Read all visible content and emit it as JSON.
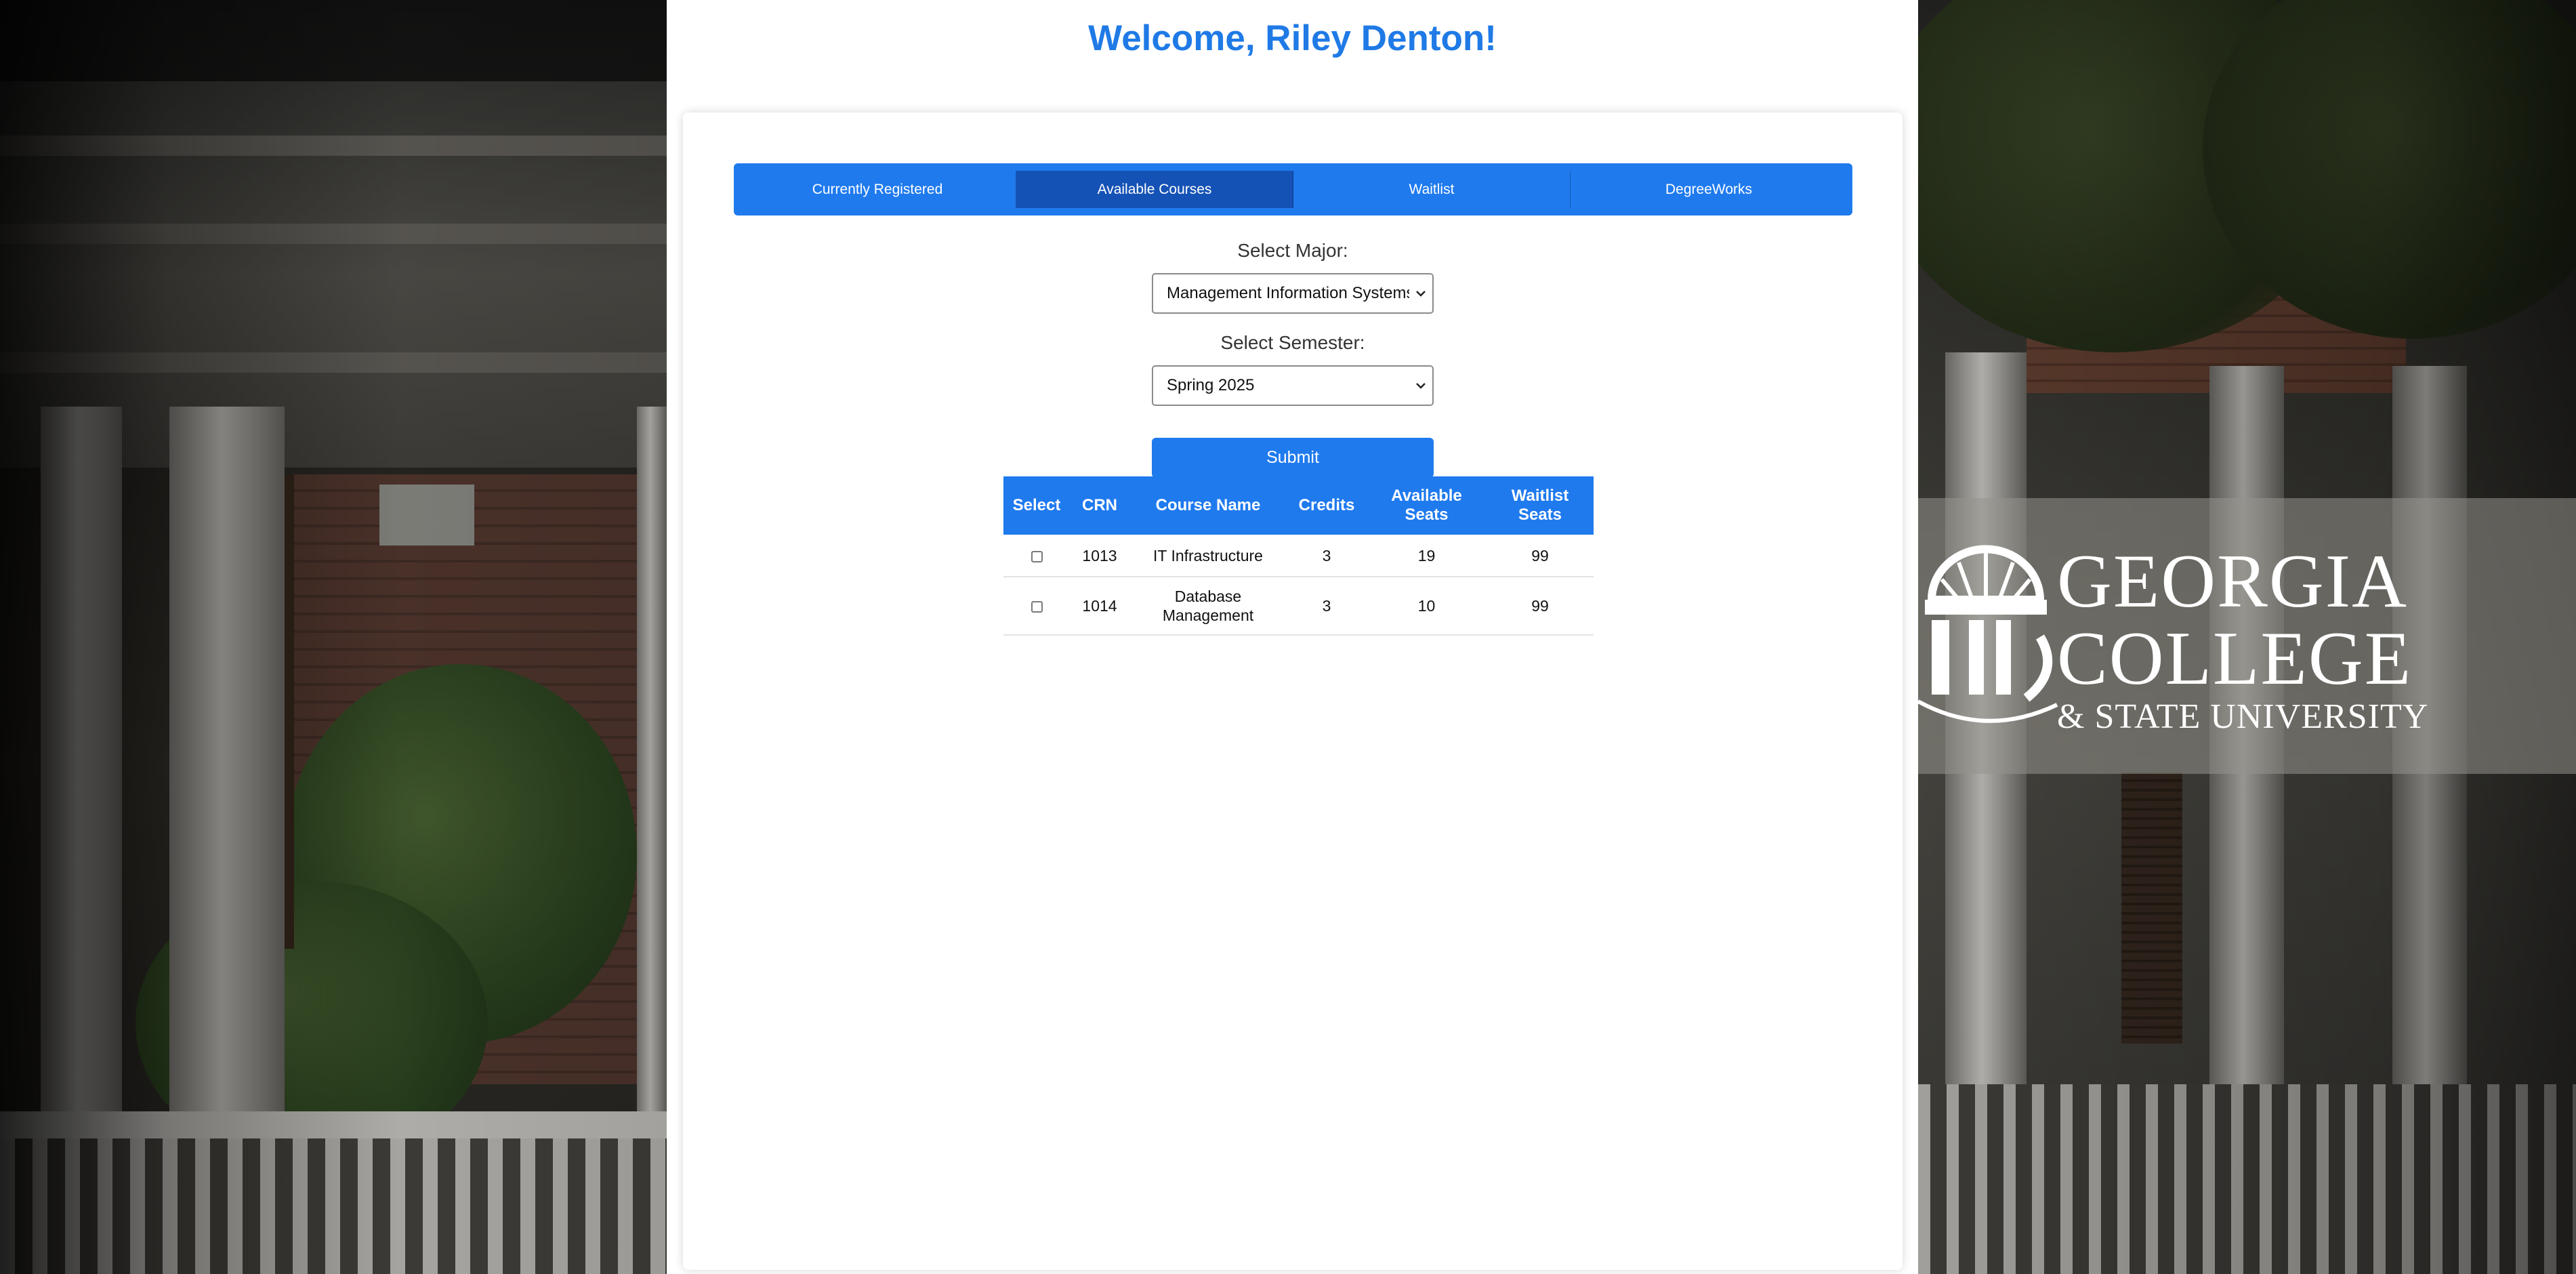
{
  "header": {
    "welcome": "Welcome, Riley Denton!"
  },
  "tabs": [
    {
      "label": "Currently Registered",
      "active": false
    },
    {
      "label": "Available Courses",
      "active": true
    },
    {
      "label": "Waitlist",
      "active": false
    },
    {
      "label": "DegreeWorks",
      "active": false
    }
  ],
  "form": {
    "major_label": "Select Major:",
    "major_value": "Management Information Systems",
    "semester_label": "Select Semester:",
    "semester_value": "Spring 2025",
    "submit_label": "Submit"
  },
  "table": {
    "headers": {
      "select": "Select",
      "crn": "CRN",
      "course_name": "Course Name",
      "credits": "Credits",
      "available_seats": "Available Seats",
      "waitlist_seats": "Waitlist Seats"
    },
    "rows": [
      {
        "checked": false,
        "crn": "1013",
        "course_name": "IT Infrastructure",
        "credits": "3",
        "available_seats": "19",
        "waitlist_seats": "99"
      },
      {
        "checked": false,
        "crn": "1014",
        "course_name": "Database Management",
        "credits": "3",
        "available_seats": "10",
        "waitlist_seats": "99"
      }
    ]
  },
  "logo": {
    "line1": "GEORGIA",
    "line2": "COLLEGE",
    "line3": "& STATE UNIVERSITY"
  },
  "colors": {
    "accent": "#1f7aee",
    "accent_active": "#1552b6",
    "title": "#1f7ae6"
  }
}
